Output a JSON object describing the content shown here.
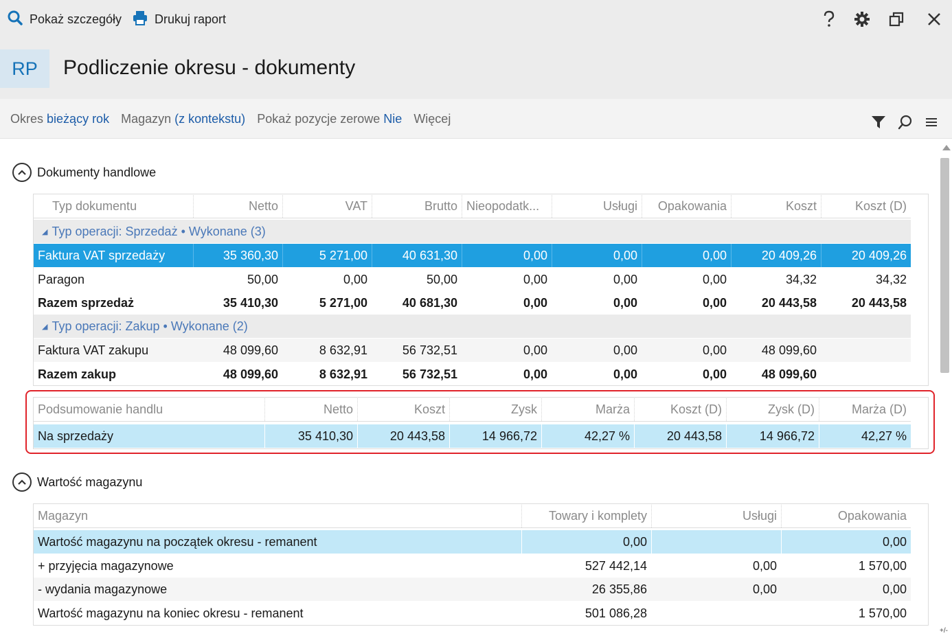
{
  "toolbar": {
    "details_label": "Pokaż szczegóły",
    "print_label": "Drukuj raport"
  },
  "header": {
    "badge": "RP",
    "title": "Podliczenie okresu - dokumenty"
  },
  "filters": {
    "period_label": "Okres",
    "period_value": "bieżący rok",
    "warehouse_label": "Magazyn",
    "warehouse_value": "(z kontekstu)",
    "zero_label": "Pokaż pozycje zerowe",
    "zero_value": "Nie",
    "more_label": "Więcej"
  },
  "sections": {
    "trade_title": "Dokumenty handlowe",
    "warehouse_title": "Wartość magazynu"
  },
  "docs_table": {
    "columns": [
      "Typ dokumentu",
      "Netto",
      "VAT",
      "Brutto",
      "Nieopodatk...",
      "Usługi",
      "Opakowania",
      "Koszt",
      "Koszt (D)"
    ],
    "group_sales": "Typ operacji: Sprzedaż • Wykonane (3)",
    "group_purchase": "Typ operacji: Zakup • Wykonane (2)",
    "rows": [
      [
        "Faktura VAT sprzedaży",
        "35 360,30",
        "5 271,00",
        "40 631,30",
        "0,00",
        "0,00",
        "0,00",
        "20 409,26",
        "20 409,26"
      ],
      [
        "Paragon",
        "50,00",
        "0,00",
        "50,00",
        "0,00",
        "0,00",
        "0,00",
        "34,32",
        "34,32"
      ],
      [
        "Razem sprzedaż",
        "35 410,30",
        "5 271,00",
        "40 681,30",
        "0,00",
        "0,00",
        "0,00",
        "20 443,58",
        "20 443,58"
      ],
      [
        "Faktura VAT zakupu",
        "48 099,60",
        "8 632,91",
        "56 732,51",
        "0,00",
        "0,00",
        "0,00",
        "48 099,60",
        ""
      ],
      [
        "Razem zakup",
        "48 099,60",
        "8 632,91",
        "56 732,51",
        "0,00",
        "0,00",
        "0,00",
        "48 099,60",
        ""
      ]
    ]
  },
  "summary_table": {
    "columns": [
      "Podsumowanie handlu",
      "Netto",
      "Koszt",
      "Zysk",
      "Marża",
      "Koszt (D)",
      "Zysk (D)",
      "Marża (D)"
    ],
    "row": [
      "Na sprzedaży",
      "35 410,30",
      "20 443,58",
      "14 966,72",
      "42,27 %",
      "20 443,58",
      "14 966,72",
      "42,27 %"
    ]
  },
  "warehouse_table": {
    "columns": [
      "Magazyn",
      "Towary i komplety",
      "Usługi",
      "Opakowania"
    ],
    "rows": [
      [
        "Wartość magazynu na początek okresu - remanent",
        "0,00",
        "",
        "0,00"
      ],
      [
        "+ przyjęcia magazynowe",
        "527 442,14",
        "0,00",
        "1 570,00"
      ],
      [
        "- wydania magazynowe",
        "26 355,86",
        "0,00",
        "0,00"
      ],
      [
        "Wartość magazynu na koniec okresu - remanent",
        "501 086,28",
        "",
        "1 570,00"
      ]
    ]
  },
  "corner_label": "+/-",
  "colors": {
    "accent": "#1f9fe0",
    "selected_light": "#c2e8f8",
    "link": "#1c5ca8",
    "highlight_border": "#e0232a"
  },
  "icons": [
    "search-icon",
    "printer-icon",
    "help-icon",
    "gear-icon",
    "restore-window-icon",
    "close-icon",
    "filter-icon",
    "search-icon",
    "menu-icon",
    "collapse-icon"
  ]
}
